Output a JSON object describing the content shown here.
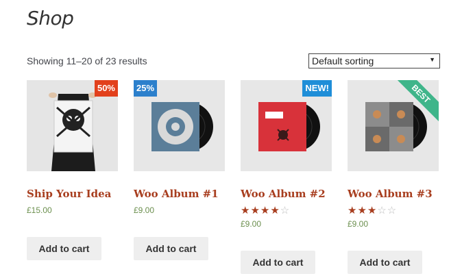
{
  "page": {
    "title": "Shop"
  },
  "result_count": "Showing 11–20 of 23 results",
  "sorting": {
    "selected": "Default sorting",
    "arrow_icon": "triangle-down-icon"
  },
  "products": [
    {
      "name": "Ship Your Idea",
      "price": "£15.00",
      "badge": "50%",
      "rating": null,
      "button": "Add to cart"
    },
    {
      "name": "Woo Album #1",
      "price": "£9.00",
      "badge": "25%",
      "rating": null,
      "button": "Add to cart"
    },
    {
      "name": "Woo Album #2",
      "price": "£9.00",
      "badge": "NEW!",
      "rating": 4,
      "button": "Add to cart"
    },
    {
      "name": "Woo Album #3",
      "price": "£9.00",
      "badge": "BEST",
      "rating": 3,
      "button": "Add to cart"
    }
  ],
  "colors": {
    "title": "#a83e1f",
    "price": "#6b8f4e",
    "badge_red": "#e2401c",
    "badge_blue": "#2c80cc",
    "badge_green": "#3fb58a"
  }
}
